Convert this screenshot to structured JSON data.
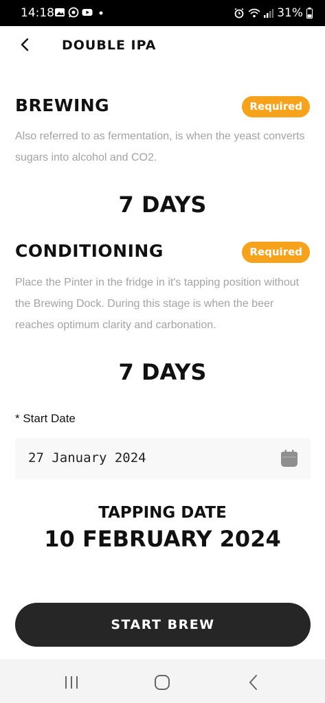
{
  "status_bar": {
    "time": "14:18",
    "battery": "31%",
    "icons": [
      "gallery-icon",
      "whatsapp-icon",
      "youtube-icon",
      "dot-icon"
    ],
    "right_icons": [
      "alarm-icon",
      "wifi-icon",
      "signal-icon",
      "battery-icon"
    ]
  },
  "header": {
    "title": "DOUBLE IPA"
  },
  "brewing": {
    "title": "BREWING",
    "badge": "Required",
    "description": "Also referred to as fermentation, is when the yeast converts sugars into alcohol and CO2.",
    "duration": "7 DAYS"
  },
  "conditioning": {
    "title": "CONDITIONING",
    "badge": "Required",
    "description": "Place the Pinter in the fridge in it's tapping position without the Brewing Dock. During this stage is when the beer reaches optimum clarity and carbonation.",
    "duration": "7 DAYS"
  },
  "start_date": {
    "label": "* Start Date",
    "value": "27 January 2024"
  },
  "tapping": {
    "label": "TAPPING DATE",
    "date": "10 FEBRUARY 2024"
  },
  "actions": {
    "start_brew": "START BREW"
  },
  "colors": {
    "accent": "#f7a21b",
    "button": "#262626",
    "muted_text": "#a3a3a3"
  }
}
